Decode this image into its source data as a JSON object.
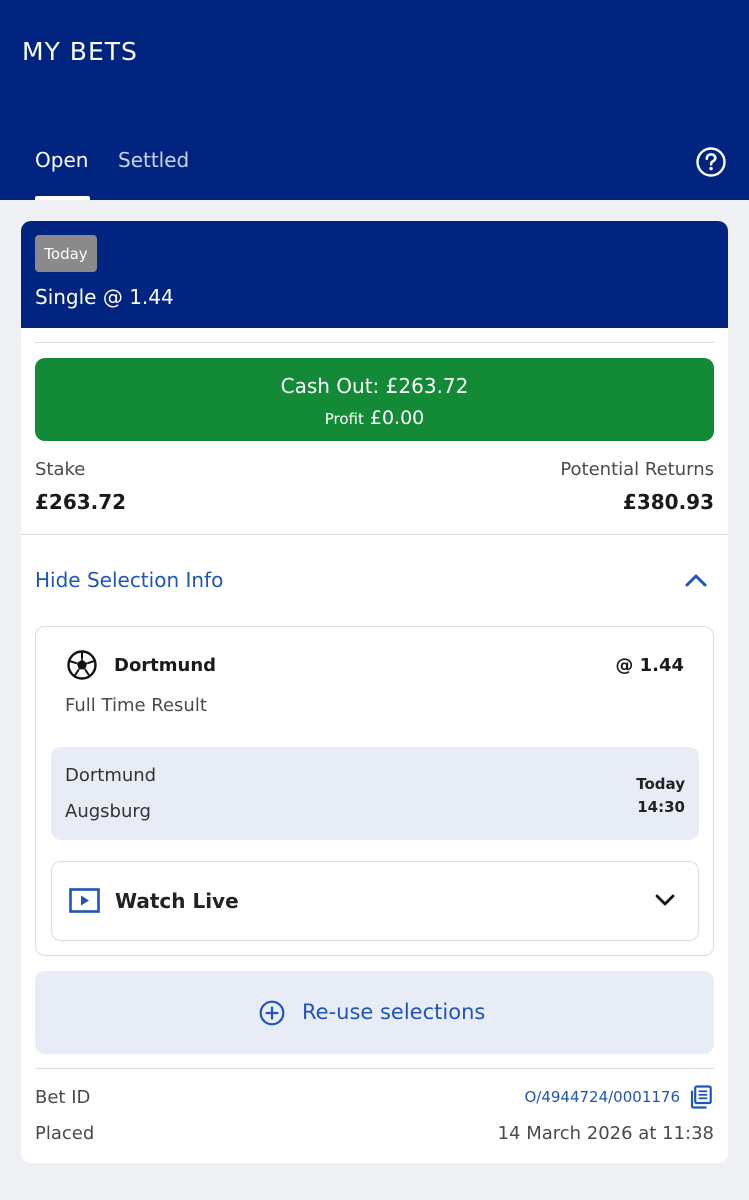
{
  "header": {
    "title": "MY BETS",
    "tabs": [
      {
        "label": "Open",
        "active": true
      },
      {
        "label": "Settled",
        "active": false
      }
    ],
    "help_icon": "question-circle-icon"
  },
  "bet": {
    "badge": "Today",
    "type_label": "Single @ 1.44",
    "cash_out": {
      "label": "Cash Out: £263.72",
      "profit_label": "Profit",
      "profit_value": "£0.00"
    },
    "stake_label": "Stake",
    "stake_value": "£263.72",
    "returns_label": "Potential Returns",
    "returns_value": "£380.93",
    "toggle_label": "Hide Selection Info",
    "selection": {
      "sport_icon": "soccer-ball-icon",
      "name": "Dortmund",
      "odds": "@ 1.44",
      "market": "Full Time Result",
      "home_team": "Dortmund",
      "away_team": "Augsburg",
      "match_day": "Today",
      "match_time": "14:30",
      "watch_label": "Watch Live"
    },
    "reuse_label": "Re-use selections",
    "bet_id_label": "Bet ID",
    "bet_id_value": "O/4944724/0001176",
    "placed_label": "Placed",
    "placed_value": "14 March 2026 at 11:38"
  },
  "colors": {
    "brand_blue": "#022481",
    "cash_out_green": "#138a36",
    "link_blue": "#1f55b8",
    "badge_grey": "#8a8a8c"
  }
}
